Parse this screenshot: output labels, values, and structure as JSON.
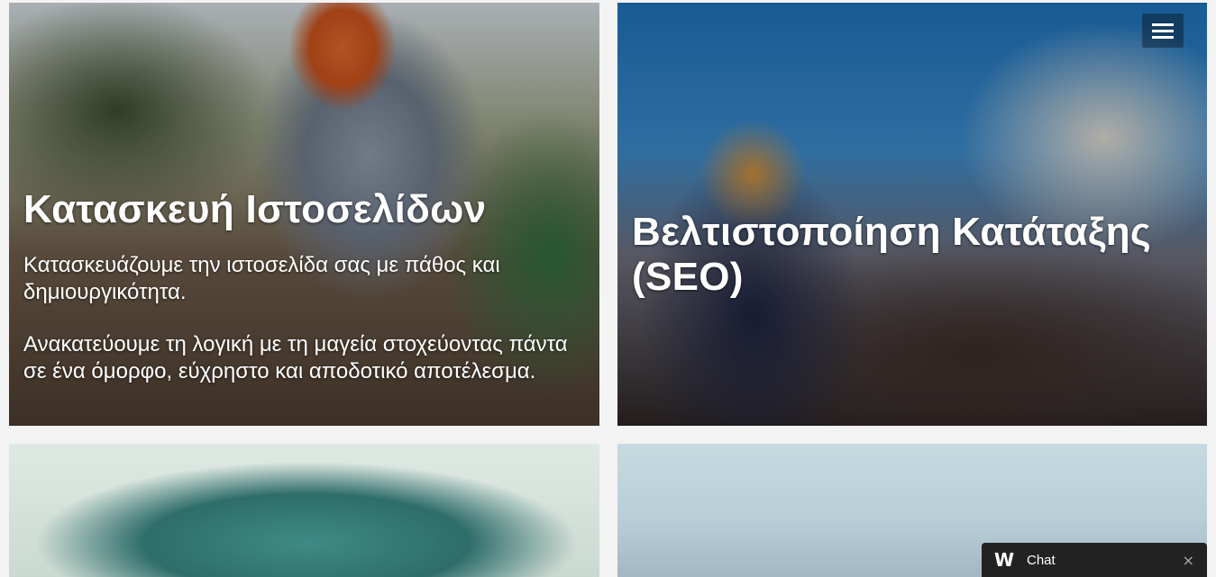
{
  "tiles": [
    {
      "title": "Κατασκευή Ιστοσελίδων",
      "text1": "Κατασκευάζουμε την ιστοσελίδα σας με πάθος και δημιουργικότητα.",
      "text2": "Ανακατεύουμε τη λογική με τη μαγεία στοχεύοντας πάντα σε ένα όμορφο, εύχρηστο και αποδοτικό αποτέλεσμα."
    },
    {
      "title": "Βελτιστοποίηση Κατάταξης (SEO)"
    }
  ],
  "menu": {
    "icon": "hamburger-menu-icon"
  },
  "chat": {
    "logo": "W",
    "label": "Chat",
    "close": "×",
    "close_icon": "close-icon"
  }
}
